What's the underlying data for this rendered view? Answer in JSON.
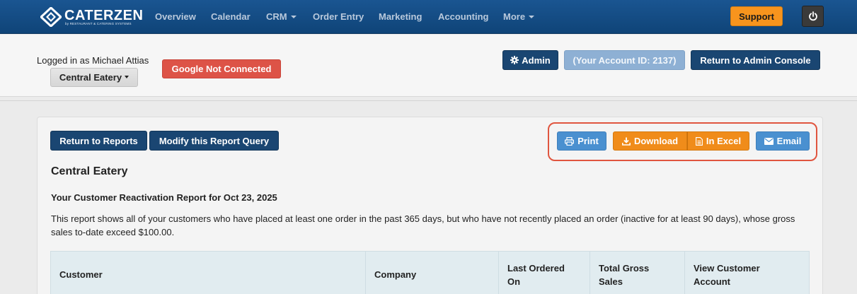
{
  "brand": {
    "name": "CATERZEN",
    "tagline": "by RESTAURANT & CATERING SYSTEMS"
  },
  "nav": {
    "items": [
      {
        "label": "Overview",
        "dropdown": false
      },
      {
        "label": "Calendar",
        "dropdown": false
      },
      {
        "label": "CRM",
        "dropdown": true
      },
      {
        "label": "Order Entry",
        "dropdown": false
      },
      {
        "label": "Marketing",
        "dropdown": false
      },
      {
        "label": "Accounting",
        "dropdown": false
      },
      {
        "label": "More",
        "dropdown": true
      }
    ],
    "support_label": "Support",
    "power_icon": "power-icon"
  },
  "header": {
    "logged_in_text": "Logged in as Michael Attias",
    "company_selector": "Central Eatery",
    "google_status": "Google Not Connected",
    "admin_label": "Admin",
    "account_id_label": "(Your Account ID: 2137)",
    "return_admin_label": "Return to Admin Console"
  },
  "report": {
    "return_reports_label": "Return to Reports",
    "modify_query_label": "Modify this Report Query",
    "print_label": "Print",
    "download_label": "Download",
    "excel_label": "In Excel",
    "email_label": "Email",
    "company_name": "Central Eatery",
    "title": "Your Customer Reactivation Report for Oct 23, 2025",
    "description": "This report shows all of your customers who have placed at least one order in the past 365 days, but who have not recently placed an order (inactive for at least 90 days), whose gross sales to-date exceed $100.00.",
    "columns": [
      {
        "line1": "Customer",
        "line2": ""
      },
      {
        "line1": "Company",
        "line2": ""
      },
      {
        "line1": "Last Ordered",
        "line2": "On"
      },
      {
        "line1": "Total Gross",
        "line2": "Sales"
      },
      {
        "line1": "View Customer",
        "line2": "Account"
      }
    ]
  },
  "colors": {
    "navbar": "#1a5591",
    "navy_button": "#1a4672",
    "support": "#f7941d",
    "google_red": "#dd5347",
    "action_blue": "#4a90d0",
    "action_orange": "#f08c1a",
    "highlight": "#e0553f"
  }
}
